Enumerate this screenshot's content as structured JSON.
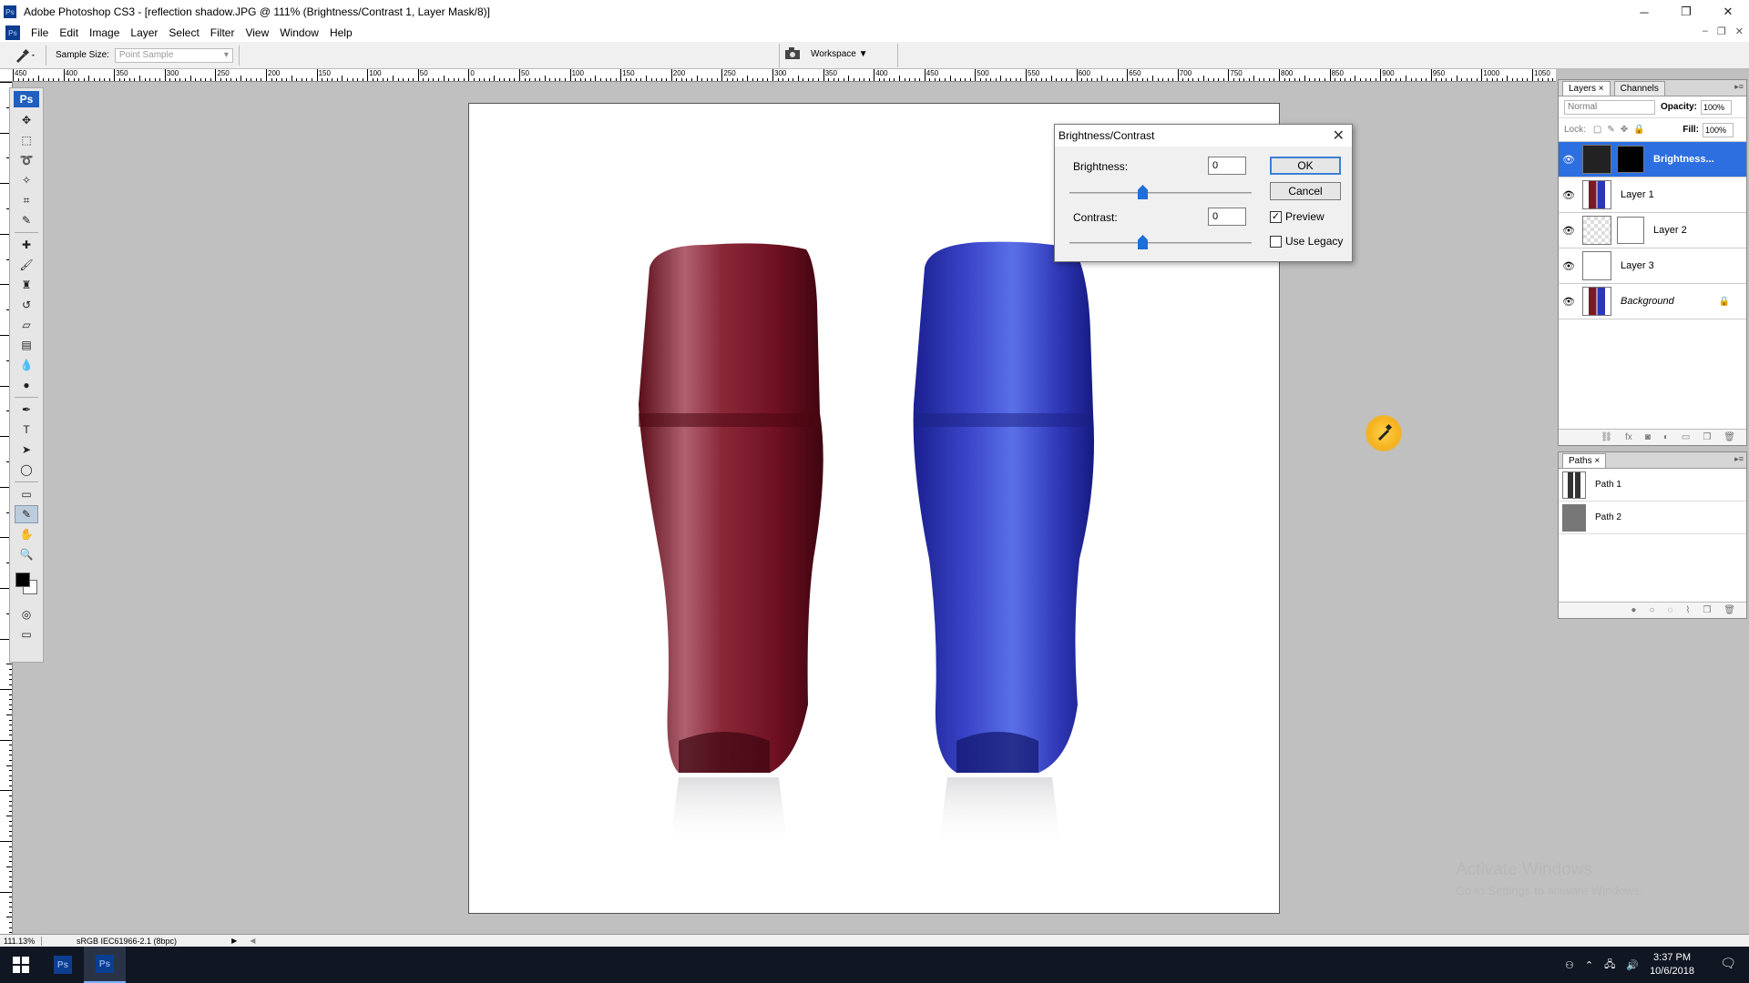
{
  "window": {
    "title": "Adobe Photoshop CS3 - [reflection shadow.JPG @ 111% (Brightness/Contrast 1, Layer Mask/8)]",
    "controls": [
      "─",
      "❐",
      "✕"
    ]
  },
  "menu": {
    "items": [
      "File",
      "Edit",
      "Image",
      "Layer",
      "Select",
      "Filter",
      "View",
      "Window",
      "Help"
    ]
  },
  "options": {
    "sample_size_label": "Sample Size:",
    "sample_size_value": "Point Sample",
    "workspace_label": "Workspace ▼"
  },
  "ruler": {
    "top_labels": [
      "450",
      "400",
      "350",
      "300",
      "250",
      "200",
      "150",
      "100",
      "50",
      "0",
      "50",
      "100",
      "150",
      "200",
      "250",
      "300",
      "350",
      "400",
      "450",
      "500",
      "550",
      "600",
      "650",
      "700",
      "750",
      "800",
      "850",
      "900",
      "950",
      "1000",
      "1050"
    ]
  },
  "dialog": {
    "title": "Brightness/Contrast",
    "brightness_label": "Brightness:",
    "brightness_value": "0",
    "contrast_label": "Contrast:",
    "contrast_value": "0",
    "brightness_slider": 0,
    "contrast_slider": 0,
    "ok_label": "OK",
    "cancel_label": "Cancel",
    "preview_label": "Preview",
    "preview_checked": true,
    "legacy_label": "Use Legacy",
    "legacy_checked": false
  },
  "layers_panel": {
    "tabs": [
      "Layers ×",
      "Channels"
    ],
    "blend_mode": "Normal",
    "opacity_label": "Opacity:",
    "opacity_value": "100%",
    "lock_label": "Lock:",
    "fill_label": "Fill:",
    "fill_value": "100%",
    "layers": [
      {
        "name": "Brightness...",
        "selected": true
      },
      {
        "name": "Layer 1",
        "selected": false
      },
      {
        "name": "Layer 2",
        "selected": false
      },
      {
        "name": "Layer 3",
        "selected": false
      },
      {
        "name": "Background",
        "selected": false
      }
    ]
  },
  "paths_panel": {
    "tab": "Paths ×",
    "paths": [
      "Path 1",
      "Path 2"
    ]
  },
  "status": {
    "zoom": "111.13%",
    "profile": "sRGB IEC61966-2.1 (8bpc)"
  },
  "watermark": {
    "line1": "Activate Windows",
    "line2": "Go to Settings to activate Windows."
  },
  "taskbar": {
    "time": "3:37 PM",
    "date": "10/6/2018"
  },
  "colors": {
    "selection_blue": "#2d6fe0",
    "red_bottle": "#7a1a26",
    "blue_bottle": "#2b36b8"
  }
}
